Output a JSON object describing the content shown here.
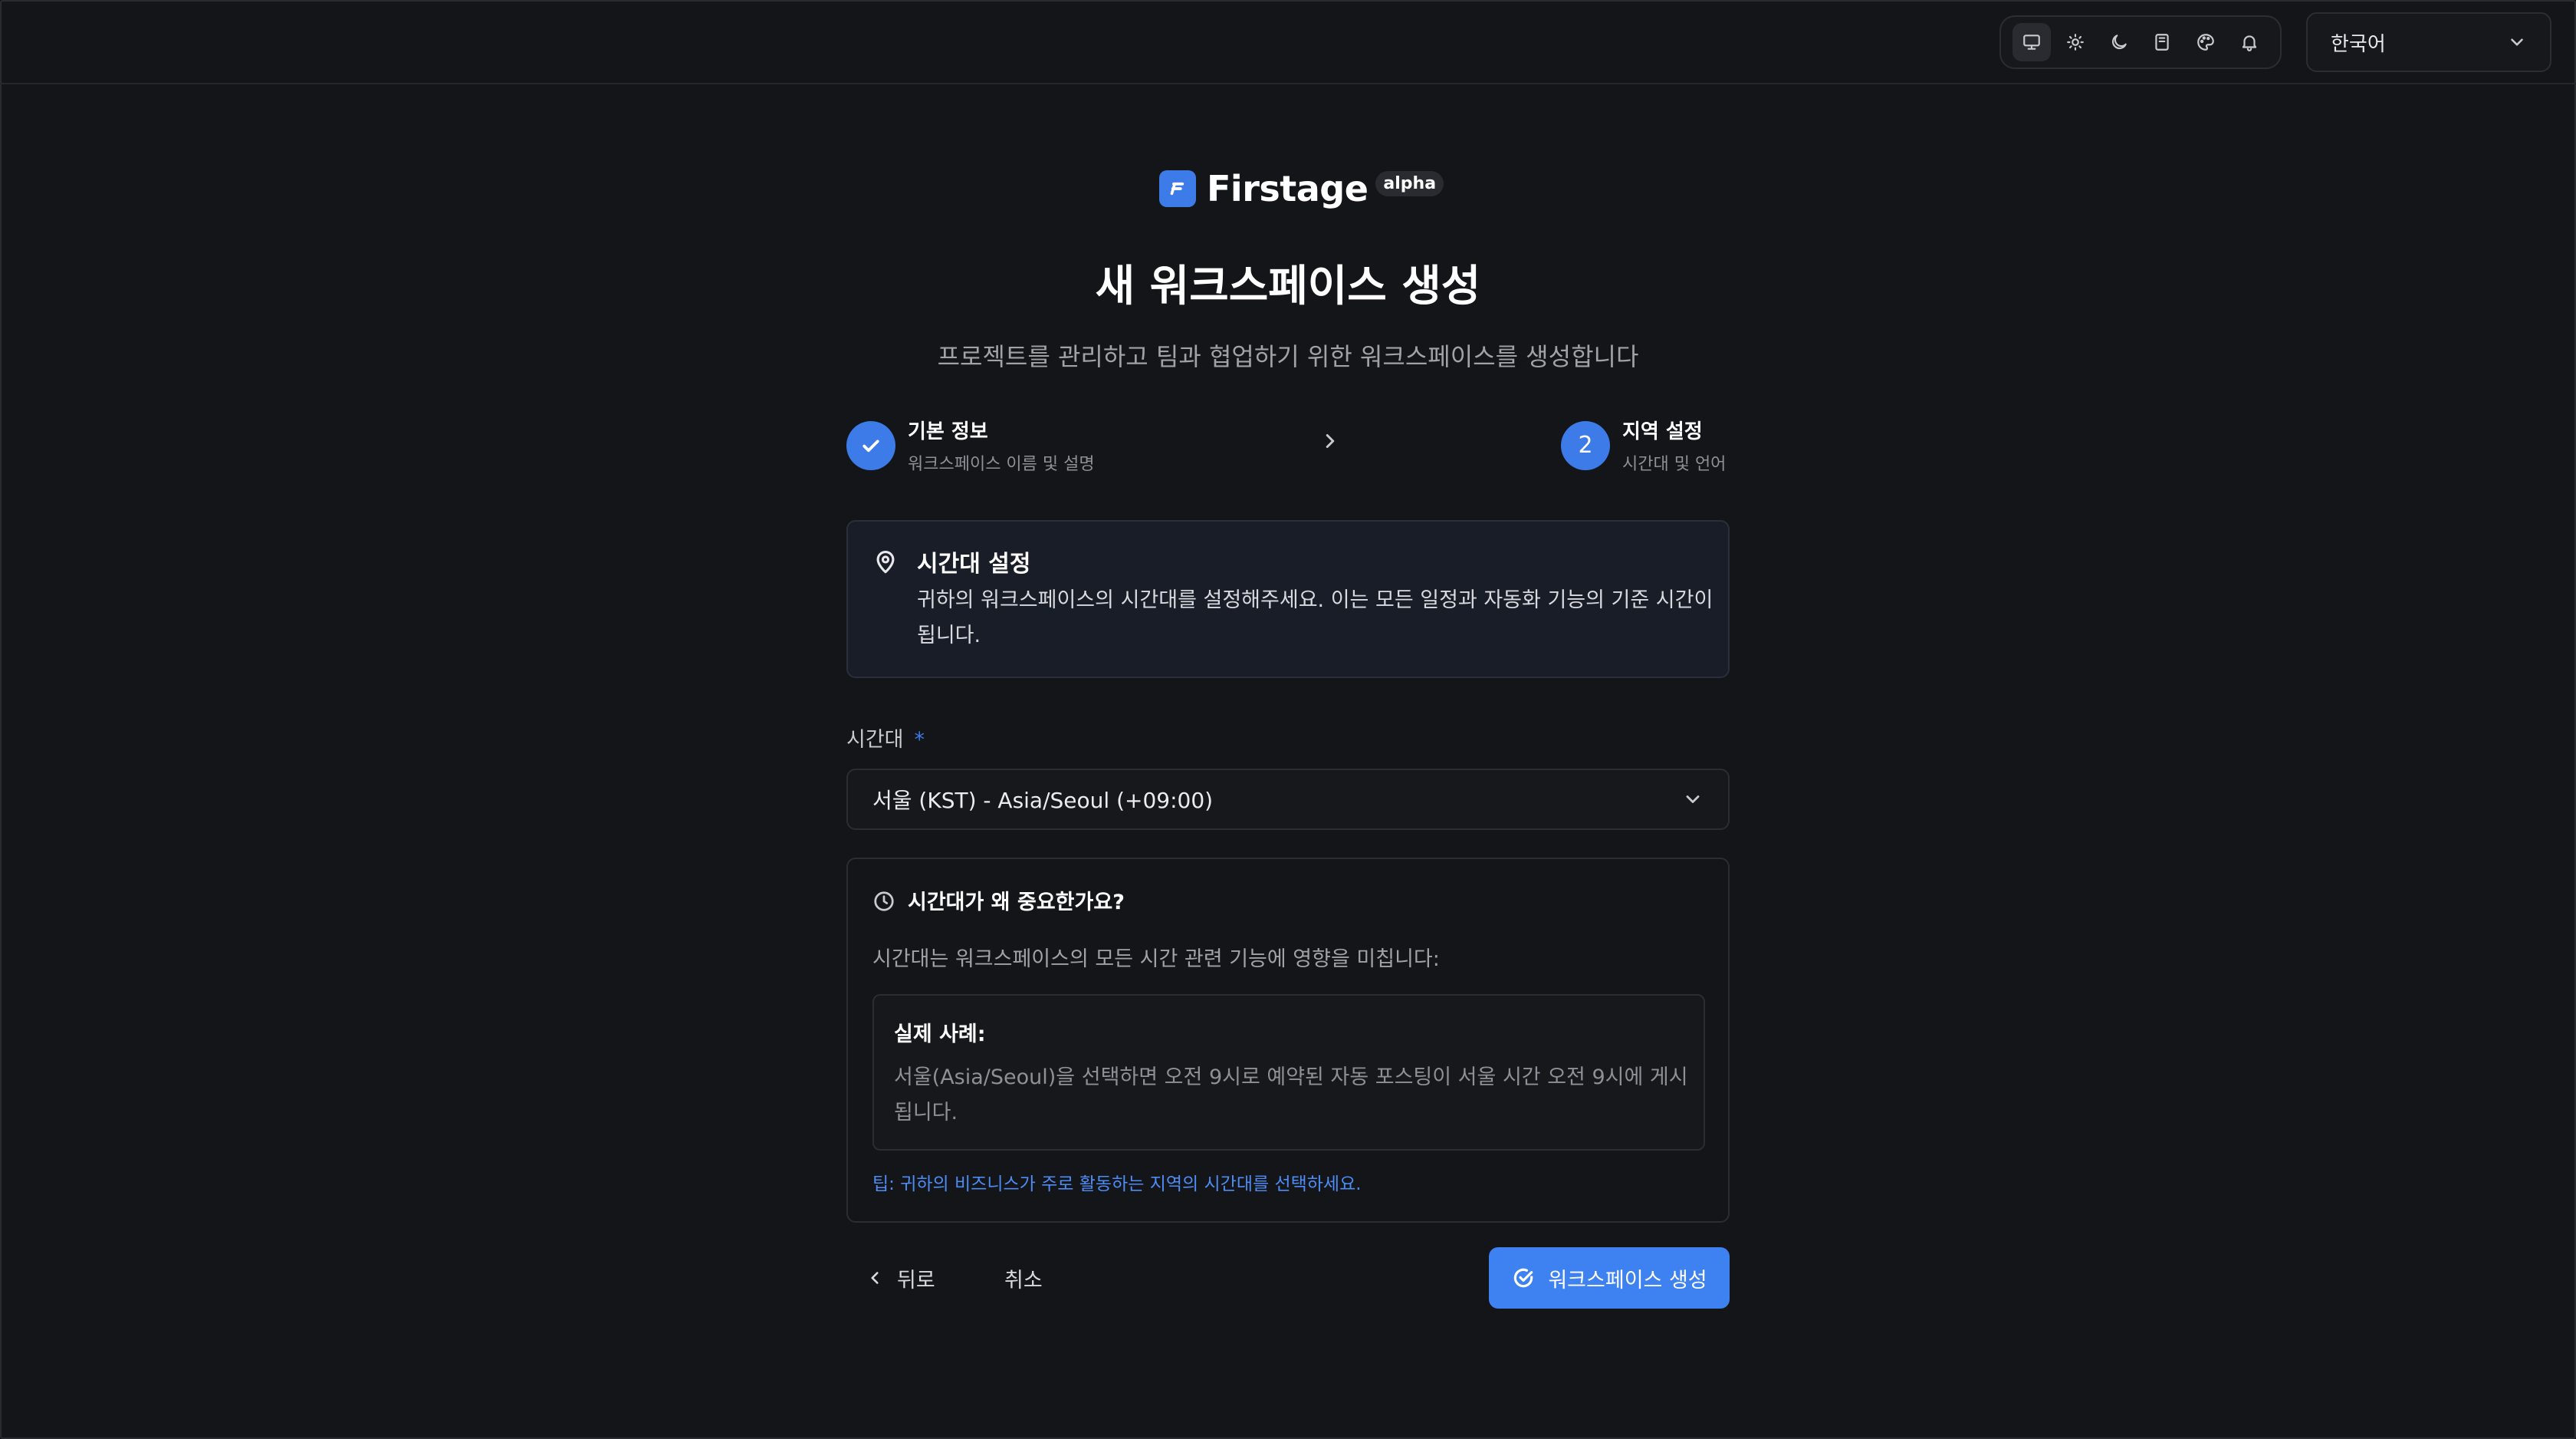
{
  "topbar": {
    "icons": [
      "monitor-icon",
      "sun-icon",
      "moon-icon",
      "book-icon",
      "palette-icon",
      "bell-icon"
    ],
    "language": "한국어"
  },
  "brand": {
    "name": "Firstage",
    "badge": "alpha",
    "color": "#3d7be8"
  },
  "header": {
    "title": "새 워크스페이스 생성",
    "subtitle": "프로젝트를 관리하고 팀과 협업하기 위한 워크스페이스를 생성합니다"
  },
  "steps": [
    {
      "label": "기본 정보",
      "sub": "워크스페이스 이름 및 설명",
      "status": "completed"
    },
    {
      "number": "2",
      "label": "지역 설정",
      "sub": "시간대 및 언어",
      "status": "current"
    }
  ],
  "info": {
    "title": "시간대 설정",
    "body": "귀하의 워크스페이스의 시간대를 설정해주세요. 이는 모든 일정과 자동화 기능의 기준 시간이 됩니다."
  },
  "timezone_field": {
    "label": "시간대",
    "required_mark": "*",
    "value": "서울 (KST) - Asia/Seoul (+09:00)"
  },
  "why": {
    "title": "시간대가 왜 중요한가요?",
    "description": "시간대는 워크스페이스의 모든 시간 관련 기능에 영향을 미칩니다:",
    "example_title": "실제 사례:",
    "example_body": "서울(Asia/Seoul)을 선택하면 오전 9시로 예약된 자동 포스팅이 서울 시간 오전 9시에 게시됩니다.",
    "tip": "팁: 귀하의 비즈니스가 주로 활동하는 지역의 시간대를 선택하세요."
  },
  "actions": {
    "back": "뒤로",
    "cancel": "취소",
    "create": "워크스페이스 생성"
  }
}
